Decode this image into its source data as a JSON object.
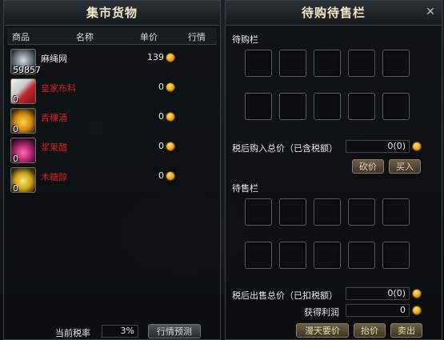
{
  "market": {
    "title": "集市货物",
    "headers": {
      "item": "商品",
      "name": "名称",
      "price": "单价",
      "trend": "行情"
    },
    "items": [
      {
        "icon": "rope-item-icon",
        "count": "59857",
        "name": "麻绳网",
        "price": "139",
        "name_color": "#e8e8e8"
      },
      {
        "icon": "cloth-item-icon",
        "count": "0",
        "name": "皇家布料",
        "price": "0",
        "name_color": "#d02020"
      },
      {
        "icon": "wine-item-icon",
        "count": "0",
        "name": "青稞酒",
        "price": "0",
        "name_color": "#d02020"
      },
      {
        "icon": "potion-item-icon",
        "count": "0",
        "name": "浆果醋",
        "price": "0",
        "name_color": "#d02020"
      },
      {
        "icon": "syrup-item-icon",
        "count": "0",
        "name": "木糖醇",
        "price": "0",
        "name_color": "#d02020"
      }
    ],
    "tax_label": "当前税率",
    "tax_value": "3%",
    "forecast_button": "行情预测"
  },
  "pending": {
    "title": "待购待售栏",
    "buy_section": "待购栏",
    "buy_total_label": "税后购入总价（已含税额）",
    "buy_total_value": "0(0)",
    "bargain_button": "砍价",
    "buy_button": "买入",
    "sell_section": "待售栏",
    "sell_total_label": "税后出售总价（已扣税额）",
    "sell_total_value": "0(0)",
    "profit_label": "获得利润",
    "profit_value": "0",
    "haggle_button": "漫天要价",
    "raise_button": "抬价",
    "sell_button": "卖出"
  },
  "colors": {
    "coin": "#e7a21e",
    "title_text": "#f2e7c9",
    "loss_red": "#d02020"
  }
}
